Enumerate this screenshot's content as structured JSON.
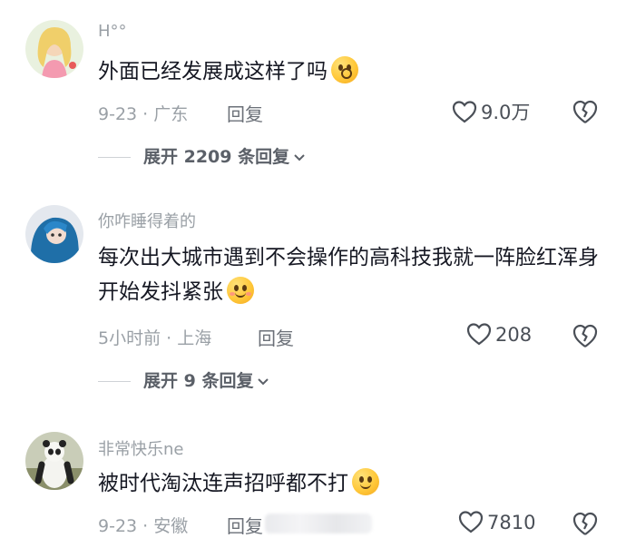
{
  "comments": [
    {
      "username": "H°°",
      "text": "外面已经发展成这样了吗",
      "emoji": "shocked-face-emoji",
      "meta": "9-23 · 广东",
      "reply": "回复",
      "likes": "9.0万",
      "expand": "展开 2209 条回复"
    },
    {
      "username": "你咋睡得着的",
      "text": "每次出大城市遇到不会操作的高科技我就一阵脸红浑身开始发抖紧张",
      "emoji": "grinning-face-emoji",
      "meta": "5小时前 · 上海",
      "reply": "回复",
      "likes": "208",
      "expand": "展开 9 条回复"
    },
    {
      "username": "非常快乐ne",
      "text": "被时代淘汰连声招呼都不打",
      "emoji": "smiling-face-emoji",
      "meta": "9-23 · 安徽",
      "reply": "回复",
      "likes": "7810"
    }
  ],
  "colors": {
    "text_primary": "#161823",
    "text_secondary": "#9aa0a6",
    "icon": "#4a4f57"
  }
}
